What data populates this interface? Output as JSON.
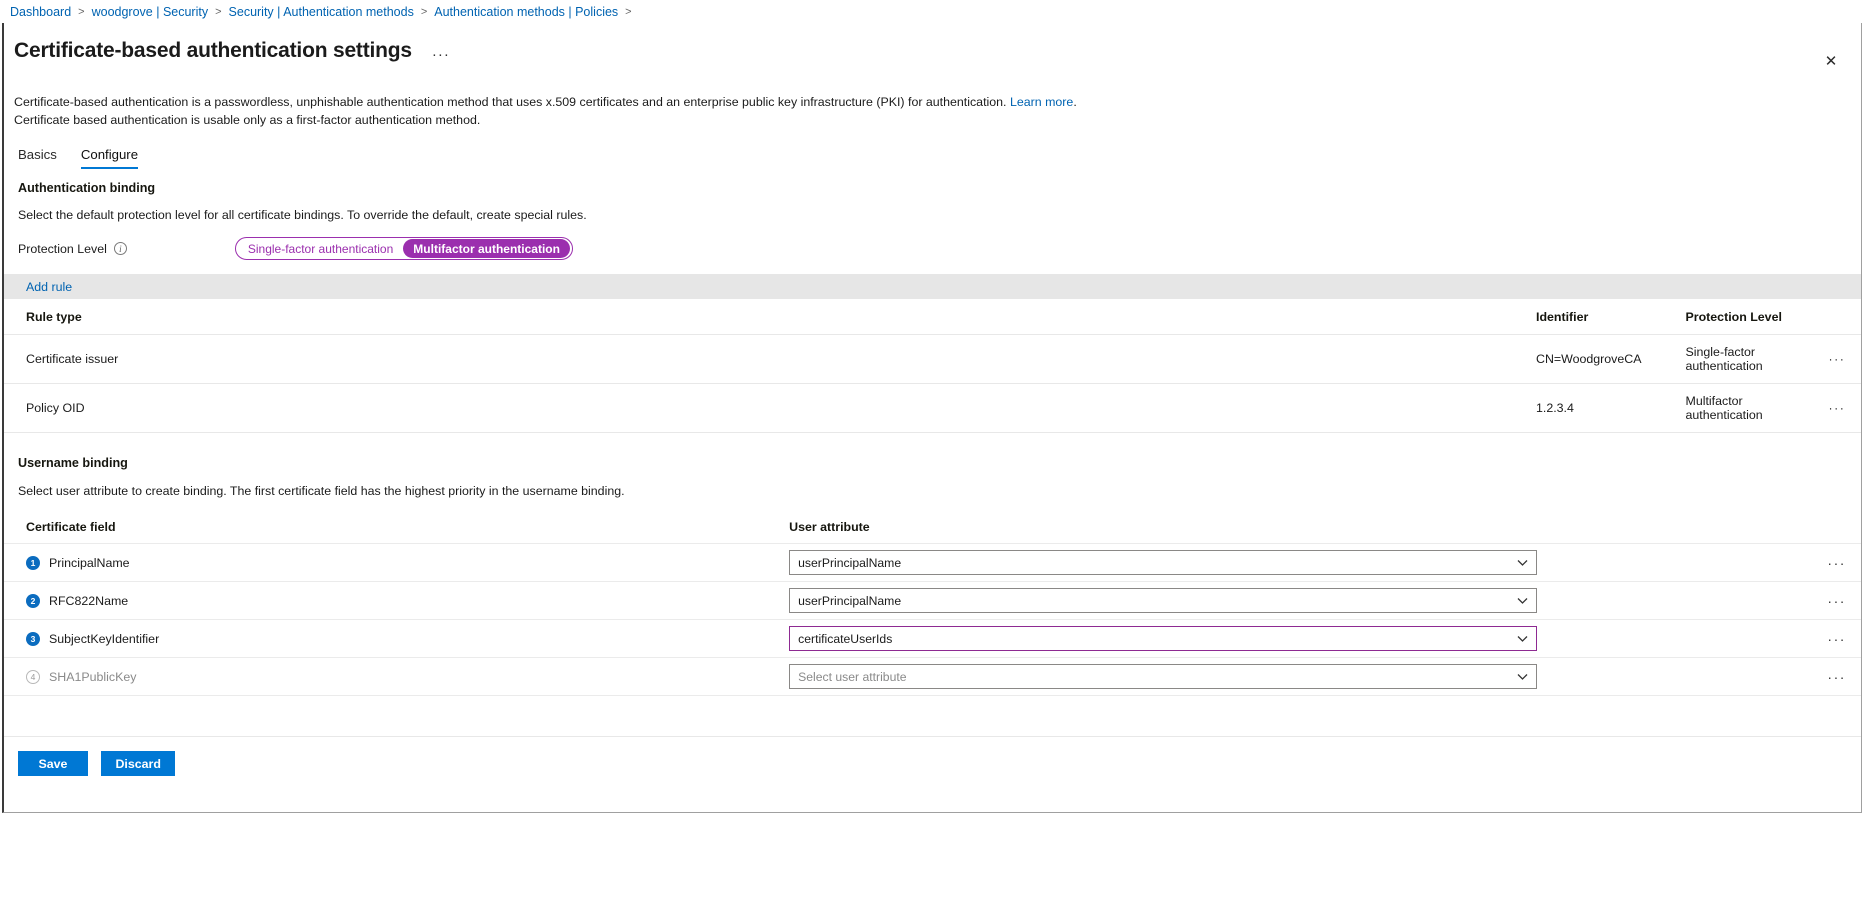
{
  "breadcrumb": {
    "items": [
      {
        "label": "Dashboard"
      },
      {
        "label": "woodgrove | Security"
      },
      {
        "label": "Security | Authentication methods"
      },
      {
        "label": "Authentication methods | Policies"
      }
    ],
    "separator": ">"
  },
  "header": {
    "title": "Certificate-based authentication settings",
    "ellipsis": "···",
    "close": "✕"
  },
  "description": {
    "line1_before_link": "Certificate-based authentication is a passwordless, unphishable authentication method that uses x.509 certificates and an enterprise public key infrastructure (PKI) for authentication. ",
    "link_text": "Learn more",
    "line1_after_link": ".",
    "line2": "Certificate based authentication is usable only as a first-factor authentication method."
  },
  "tabs": [
    {
      "label": "Basics",
      "active": false
    },
    {
      "label": "Configure",
      "active": true
    }
  ],
  "authentication_binding": {
    "heading": "Authentication binding",
    "subtext": "Select the default protection level for all certificate bindings. To override the default, create special rules.",
    "protection_level_label": "Protection Level",
    "info_glyph": "i",
    "options": [
      {
        "label": "Single-factor authentication",
        "selected": false
      },
      {
        "label": "Multifactor authentication",
        "selected": true
      }
    ],
    "accent_color": "#9b2fae",
    "toolbar": {
      "add_rule_label": "Add rule"
    },
    "table": {
      "columns": [
        "Rule type",
        "Identifier",
        "Protection Level"
      ],
      "rows": [
        {
          "rule_type": "Certificate issuer",
          "identifier": "CN=WoodgroveCA",
          "protection_level": "Single-factor authentication",
          "actions": "···"
        },
        {
          "rule_type": "Policy OID",
          "identifier": "1.2.3.4",
          "protection_level": "Multifactor authentication",
          "actions": "···"
        }
      ]
    }
  },
  "username_binding": {
    "heading": "Username binding",
    "subtext": "Select user attribute to create binding. The first certificate field has the highest priority in the username binding.",
    "columns": [
      "Certificate field",
      "User attribute"
    ],
    "rows": [
      {
        "priority": "1",
        "priority_filled": true,
        "certificate_field": "PrincipalName",
        "user_attribute": "userPrincipalName",
        "is_placeholder": false,
        "focused": false,
        "actions": "···"
      },
      {
        "priority": "2",
        "priority_filled": true,
        "certificate_field": "RFC822Name",
        "user_attribute": "userPrincipalName",
        "is_placeholder": false,
        "focused": false,
        "actions": "···"
      },
      {
        "priority": "3",
        "priority_filled": true,
        "certificate_field": "SubjectKeyIdentifier",
        "user_attribute": "certificateUserIds",
        "is_placeholder": false,
        "focused": true,
        "actions": "···"
      },
      {
        "priority": "4",
        "priority_filled": false,
        "certificate_field": "SHA1PublicKey",
        "user_attribute": "Select user attribute",
        "is_placeholder": true,
        "focused": false,
        "actions": "···"
      }
    ]
  },
  "footer": {
    "save_label": "Save",
    "discard_label": "Discard",
    "button_color": "#0078d4"
  }
}
